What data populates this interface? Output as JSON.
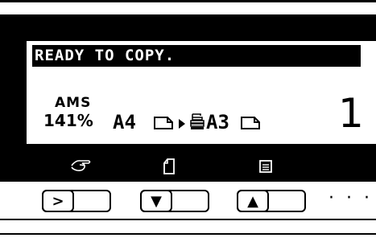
{
  "display": {
    "status_message": "READY TO COPY.",
    "mode_label": "AMS",
    "zoom_ratio": "141%",
    "original_size": "A4",
    "copy_size": "A3",
    "copy_count": "1"
  },
  "soft_keys": [
    {
      "icon": "hand-finger-icon"
    },
    {
      "icon": "portrait-sheet-icon"
    },
    {
      "icon": "document-lines-icon"
    }
  ],
  "buttons": {
    "key1_label": ">",
    "key2_label": "▼",
    "key3_label": "▲",
    "more_label": "· · ·"
  },
  "colors": {
    "panel": "#000000",
    "lcd": "#ffffff"
  }
}
